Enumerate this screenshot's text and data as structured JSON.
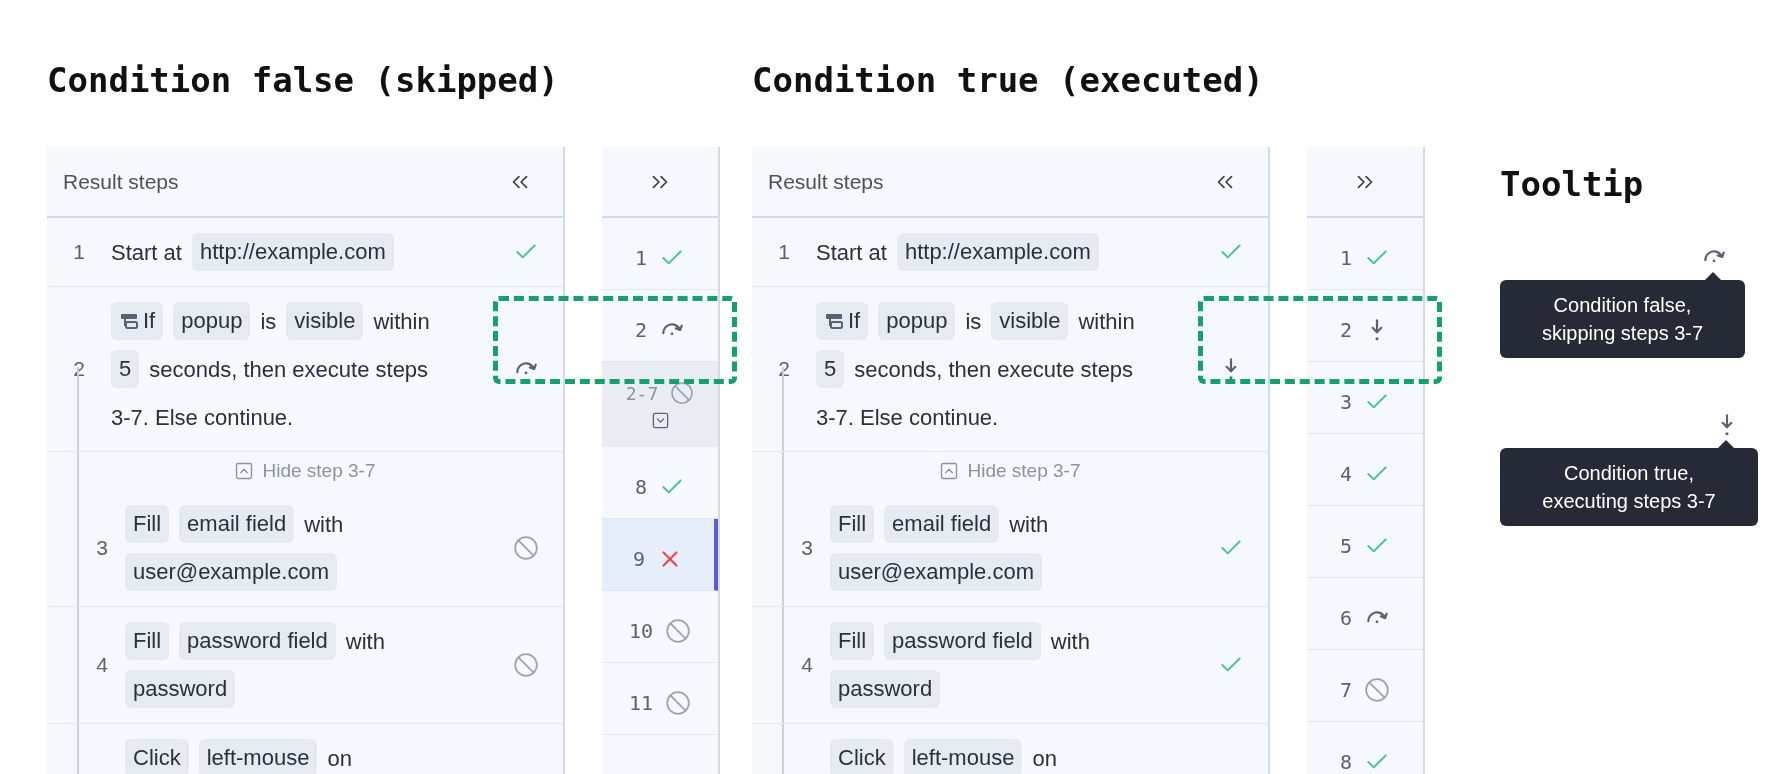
{
  "sections": [
    {
      "title": "Condition false (skipped)",
      "callout": true,
      "panel": {
        "header": "Result steps",
        "steps": [
          {
            "number": "1",
            "kind": "passed",
            "lines": [
              [
                {
                  "kind": "text",
                  "text": "Start at"
                },
                {
                  "kind": "tag",
                  "text": "http://example.com"
                }
              ]
            ]
          },
          {
            "number": "2",
            "kind": "condition_false",
            "lines": [
              [
                {
                  "kind": "condition",
                  "text": "If"
                },
                {
                  "kind": "tag",
                  "text": "popup"
                },
                {
                  "kind": "text",
                  "text": "is"
                },
                {
                  "kind": "tag",
                  "text": "visible"
                },
                {
                  "kind": "text",
                  "text": "within"
                }
              ],
              [
                {
                  "kind": "tag",
                  "text": "5"
                },
                {
                  "kind": "text",
                  "text": "seconds, then execute steps"
                }
              ],
              [
                {
                  "kind": "text",
                  "text": "3-7. Else continue."
                }
              ]
            ],
            "toggle": {
              "label": "Hide step 3-7",
              "expanded": true
            },
            "children": [
              {
                "number": "3",
                "kind": "skipped",
                "lines": [
                  [
                    {
                      "kind": "tag",
                      "text": "Fill"
                    },
                    {
                      "kind": "tag",
                      "text": "email field"
                    },
                    {
                      "kind": "text",
                      "text": "with"
                    }
                  ],
                  [
                    {
                      "kind": "tag",
                      "text": "user@example.com"
                    }
                  ]
                ]
              },
              {
                "number": "4",
                "kind": "skipped",
                "lines": [
                  [
                    {
                      "kind": "tag",
                      "text": "Fill"
                    },
                    {
                      "kind": "tag",
                      "text": "password field"
                    },
                    {
                      "kind": "text",
                      "text": "with"
                    }
                  ],
                  [
                    {
                      "kind": "tag",
                      "text": "password"
                    }
                  ]
                ]
              },
              {
                "lines": [
                  [
                    {
                      "kind": "tag",
                      "text": "Click"
                    },
                    {
                      "kind": "tag",
                      "text": "left-mouse"
                    },
                    {
                      "kind": "text",
                      "text": "on"
                    }
                  ]
                ]
              }
            ]
          }
        ]
      },
      "mini": [
        {
          "kind": "passed",
          "number": "1",
          "grouped": false,
          "selected": false
        },
        {
          "kind": "condition_false",
          "number": "2",
          "grouped": false,
          "selected": false
        },
        {
          "kind": "skipped",
          "number": "2-7",
          "grouped": true,
          "expanded": false,
          "selected": false
        },
        {
          "kind": "passed",
          "number": "8",
          "grouped": false,
          "selected": false
        },
        {
          "kind": "failed",
          "number": "9",
          "grouped": false,
          "selected": true
        },
        {
          "kind": "skipped",
          "number": "10",
          "grouped": false,
          "selected": false
        },
        {
          "kind": "skipped",
          "number": "11",
          "grouped": false,
          "selected": false
        }
      ]
    },
    {
      "title": "Condition true (executed)",
      "callout": true,
      "panel": {
        "header": "Result steps",
        "steps": [
          {
            "number": "1",
            "kind": "passed",
            "lines": [
              [
                {
                  "kind": "text",
                  "text": "Start at"
                },
                {
                  "kind": "tag",
                  "text": "http://example.com"
                }
              ]
            ]
          },
          {
            "number": "2",
            "kind": "condition_true",
            "lines": [
              [
                {
                  "kind": "condition",
                  "text": "If"
                },
                {
                  "kind": "tag",
                  "text": "popup"
                },
                {
                  "kind": "text",
                  "text": "is"
                },
                {
                  "kind": "tag",
                  "text": "visible"
                },
                {
                  "kind": "text",
                  "text": "within"
                }
              ],
              [
                {
                  "kind": "tag",
                  "text": "5"
                },
                {
                  "kind": "text",
                  "text": "seconds, then execute steps"
                }
              ],
              [
                {
                  "kind": "text",
                  "text": "3-7. Else continue."
                }
              ]
            ],
            "toggle": {
              "label": "Hide step 3-7",
              "expanded": true
            },
            "children": [
              {
                "number": "3",
                "kind": "passed",
                "lines": [
                  [
                    {
                      "kind": "tag",
                      "text": "Fill"
                    },
                    {
                      "kind": "tag",
                      "text": "email field"
                    },
                    {
                      "kind": "text",
                      "text": "with"
                    }
                  ],
                  [
                    {
                      "kind": "tag",
                      "text": "user@example.com"
                    }
                  ]
                ]
              },
              {
                "number": "4",
                "kind": "passed",
                "lines": [
                  [
                    {
                      "kind": "tag",
                      "text": "Fill"
                    },
                    {
                      "kind": "tag",
                      "text": "password field"
                    },
                    {
                      "kind": "text",
                      "text": "with"
                    }
                  ],
                  [
                    {
                      "kind": "tag",
                      "text": "password"
                    }
                  ]
                ]
              },
              {
                "lines": [
                  [
                    {
                      "kind": "tag",
                      "text": "Click"
                    },
                    {
                      "kind": "tag",
                      "text": "left-mouse"
                    },
                    {
                      "kind": "text",
                      "text": "on"
                    }
                  ]
                ]
              }
            ]
          }
        ]
      },
      "mini": [
        {
          "kind": "passed",
          "number": "1",
          "grouped": false,
          "selected": false
        },
        {
          "kind": "condition_true",
          "number": "2",
          "grouped": false,
          "selected": false
        },
        {
          "kind": "passed",
          "number": "3",
          "grouped": false,
          "selected": false
        },
        {
          "kind": "passed",
          "number": "4",
          "grouped": false,
          "selected": false
        },
        {
          "kind": "passed",
          "number": "5",
          "grouped": false,
          "selected": false
        },
        {
          "kind": "condition_false",
          "number": "6",
          "grouped": false,
          "selected": false
        },
        {
          "kind": "skipped",
          "number": "7",
          "grouped": false,
          "selected": false
        },
        {
          "kind": "passed",
          "number": "8",
          "grouped": false,
          "selected": false
        }
      ]
    }
  ],
  "tooltips": {
    "title": "Tooltip",
    "items": [
      {
        "kind": "condition_false",
        "lines": [
          "Condition false,",
          "skipping steps 3-7"
        ]
      },
      {
        "kind": "condition_true",
        "lines": [
          "Condition true,",
          "executing steps 3-7"
        ]
      }
    ]
  }
}
